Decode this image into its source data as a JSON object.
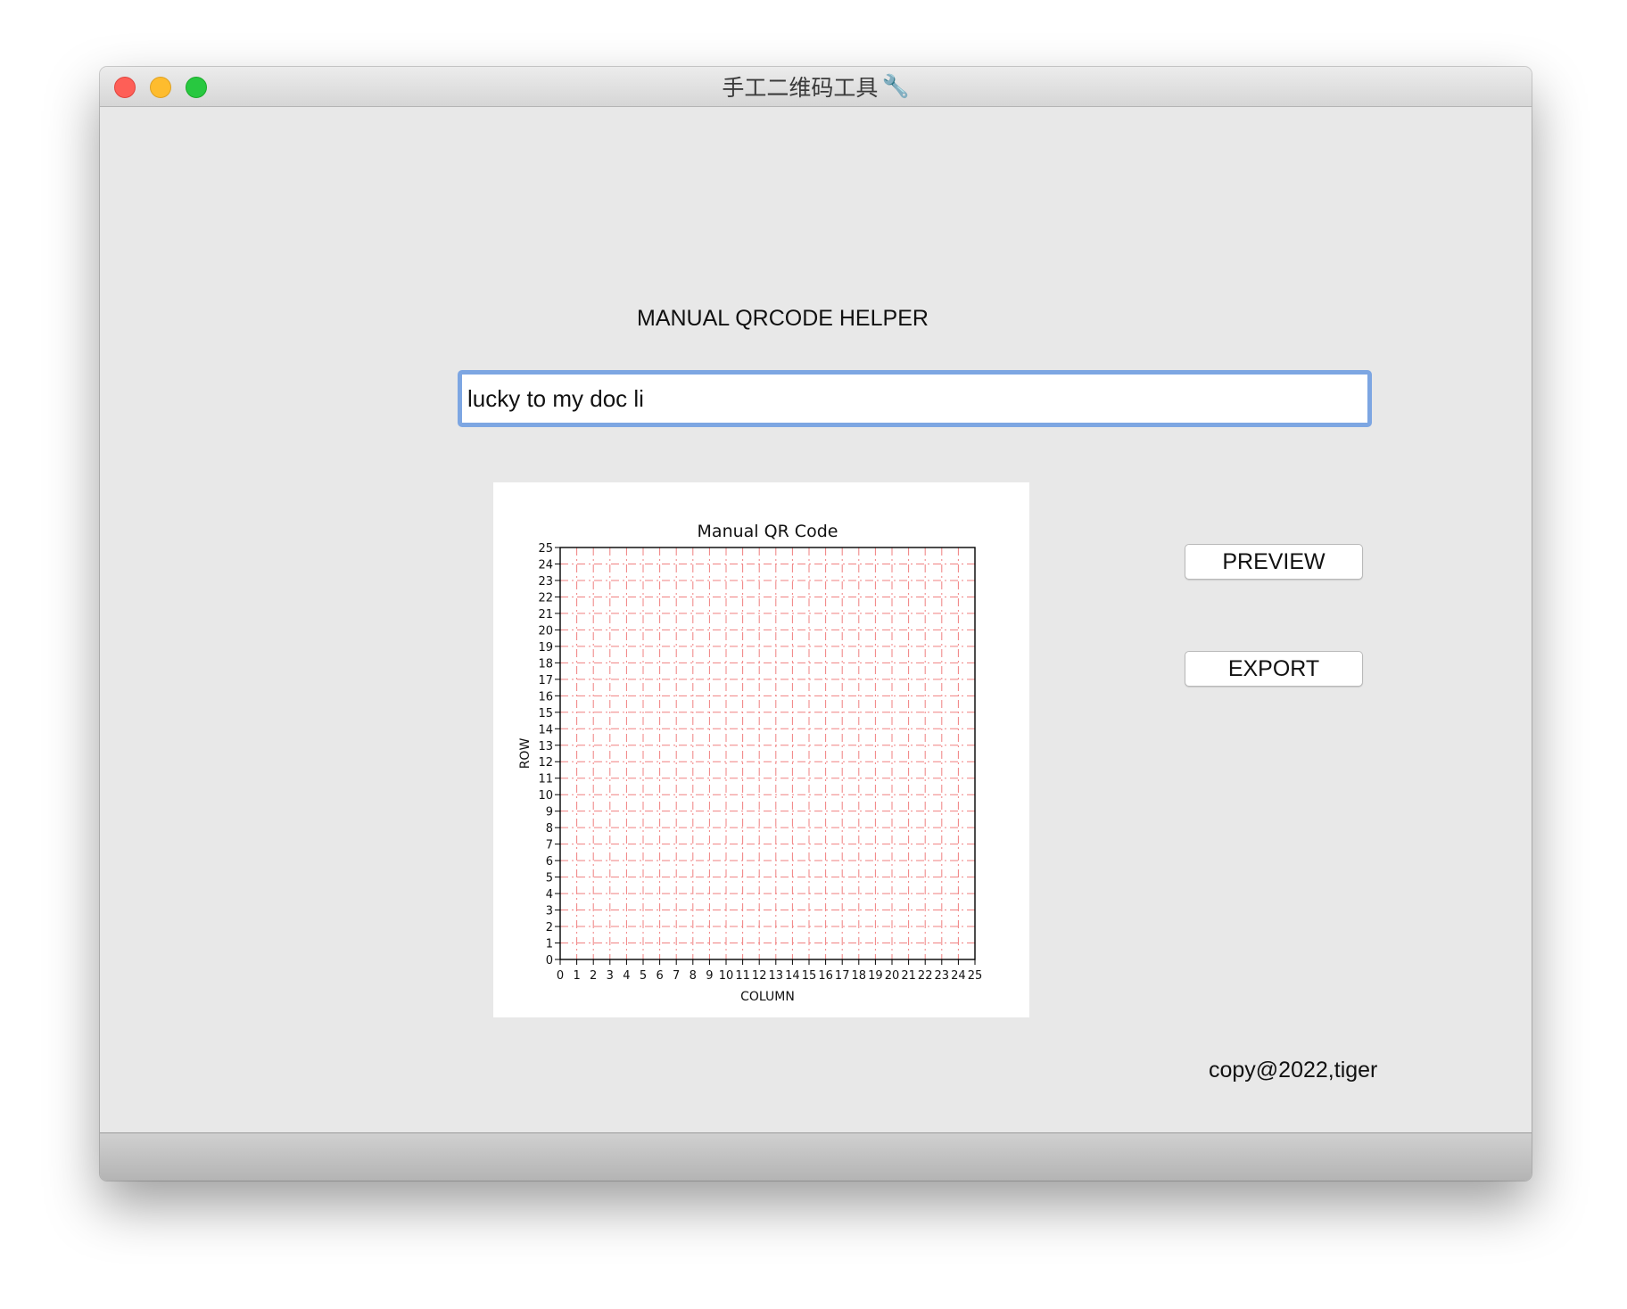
{
  "window": {
    "title": "手工二维码工具",
    "title_icon": "wrench-icon"
  },
  "main": {
    "heading": "MANUAL QRCODE HELPER",
    "input_value": "lucky to my doc li",
    "preview_label": "PREVIEW",
    "export_label": "EXPORT",
    "copyright": "copy@2022,tiger"
  },
  "colors": {
    "input_focus": "#7da6e2",
    "grid": "#f08080",
    "close": "#fe5f57",
    "minimize": "#febc2e",
    "maximize": "#28c840"
  },
  "chart_data": {
    "type": "scatter",
    "title": "Manual QR Code",
    "xlabel": "COLUMN",
    "ylabel": "ROW",
    "xlim": [
      0,
      25
    ],
    "ylim": [
      0,
      25
    ],
    "xticks": [
      "0",
      "1",
      "2",
      "3",
      "4",
      "5",
      "6",
      "7",
      "8",
      "9",
      "10",
      "11",
      "12",
      "13",
      "14",
      "15",
      "16",
      "17",
      "18",
      "19",
      "20",
      "21",
      "22",
      "23",
      "24",
      "25"
    ],
    "yticks": [
      "0",
      "1",
      "2",
      "3",
      "4",
      "5",
      "6",
      "7",
      "8",
      "9",
      "10",
      "11",
      "12",
      "13",
      "14",
      "15",
      "16",
      "17",
      "18",
      "19",
      "20",
      "21",
      "22",
      "23",
      "24",
      "25"
    ],
    "grid": true,
    "grid_style": "dashed",
    "points": []
  }
}
